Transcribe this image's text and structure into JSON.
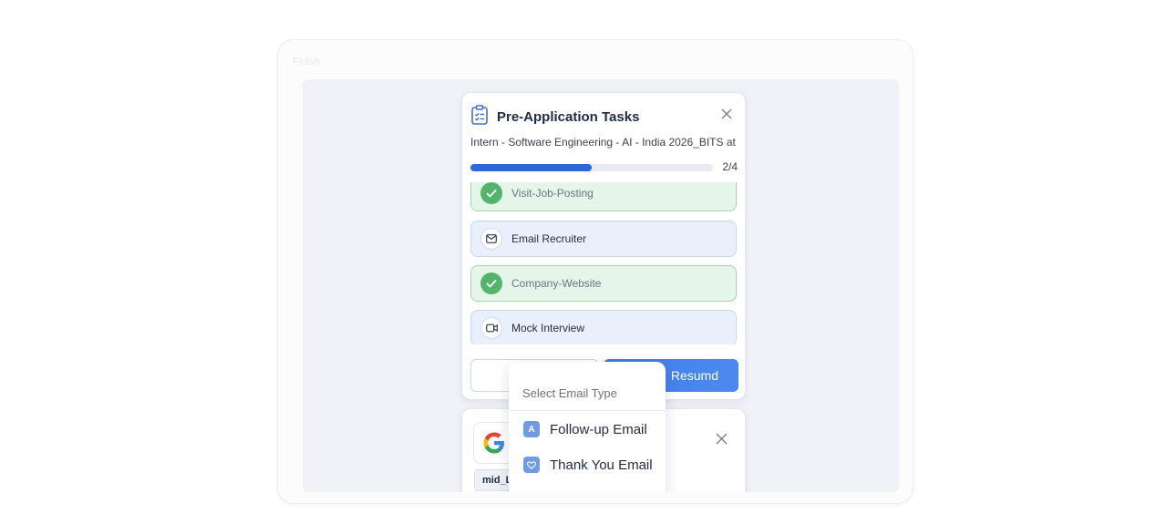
{
  "device": {
    "title": "Finish"
  },
  "task_card": {
    "title": "Pre-Application Tasks",
    "job_title": "Intern - Software Engineering - AI - India 2026_BITS at ...",
    "progress": {
      "completed": 2,
      "total": 4,
      "fraction": 0.5,
      "label": "2/4"
    },
    "tasks": [
      {
        "label": "Visit-Job-Posting",
        "status": "done",
        "icon": "check-icon"
      },
      {
        "label": "Email Recruiter",
        "status": "todo",
        "icon": "mail-icon"
      },
      {
        "label": "Company-Website",
        "status": "done",
        "icon": "check-icon"
      },
      {
        "label": "Mock Interview",
        "status": "todo",
        "icon": "video-icon"
      }
    ],
    "primary_button_label": "Resumd"
  },
  "job_card": {
    "company_logo": "google-logo",
    "tag_label": "mid_L"
  },
  "dropdown": {
    "heading": "Select Email Type",
    "items": [
      {
        "label": "Follow-up Email",
        "icon": "A"
      },
      {
        "label": "Thank You Email",
        "icon": "heart-icon"
      }
    ]
  },
  "colors": {
    "accent": "#2f66d6",
    "done_bg": "#e6f5ea",
    "done_border": "#9fd8ad",
    "todo_bg": "#eaf0fb",
    "check_green": "#52b569"
  }
}
